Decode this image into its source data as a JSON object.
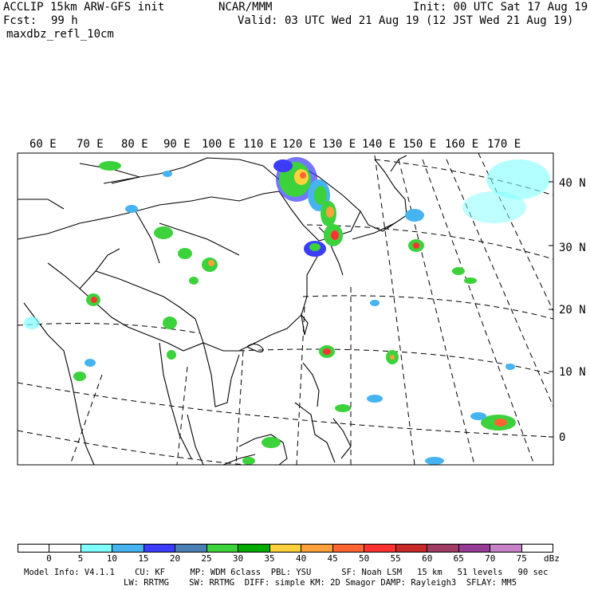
{
  "header": {
    "line1_left": "ACCLIP 15km ARW-GFS init",
    "line1_center": "NCAR/MMM",
    "line1_right": "Init: 00 UTC Sat 17 Aug 19",
    "fcst_label": "Fcst:",
    "fcst_value": "99 h",
    "valid": "Valid: 03 UTC Wed 21 Aug 19 (12 JST Wed 21 Aug 19)",
    "field": "maxdbz_refl_10cm"
  },
  "map": {
    "lon_labels": [
      "60 E",
      "70 E",
      "80 E",
      "90 E",
      "100 E",
      "110 E",
      "120 E",
      "130 E",
      "140 E",
      "150 E",
      "160 E",
      "170 E"
    ],
    "lat_labels": [
      "40 N",
      "30 N",
      "20 N",
      "10 N",
      "0"
    ],
    "colors": {
      "land_line": "#000000",
      "grid_line": "#000000",
      "background": "#ffffff"
    }
  },
  "colorbar": {
    "labels": [
      "0",
      "5",
      "10",
      "15",
      "20",
      "25",
      "30",
      "35",
      "40",
      "45",
      "50",
      "55",
      "60",
      "65",
      "70",
      "75"
    ],
    "unit": "dBz",
    "colors": [
      "#ffffff",
      "#ffffff",
      "#80ffff",
      "#46b4f0",
      "#3c3cff",
      "#4a7eb4",
      "#3cd23c",
      "#00aa00",
      "#ffd23c",
      "#ffa03c",
      "#ff6432",
      "#ff3232",
      "#c82828",
      "#a03c64",
      "#963c96",
      "#c882c8",
      "#ffffff"
    ]
  },
  "footer": {
    "line1": "Model Info: V4.1.1    CU: KF     MP: WDM 6class  PBL: YSU      SF: Noah LSM   15 km   51 levels   90 sec",
    "line2": "LW: RRTMG    SW: RRTMG  DIFF: simple KM: 2D Smagor DAMP: Rayleigh3  SFLAY: MM5"
  }
}
